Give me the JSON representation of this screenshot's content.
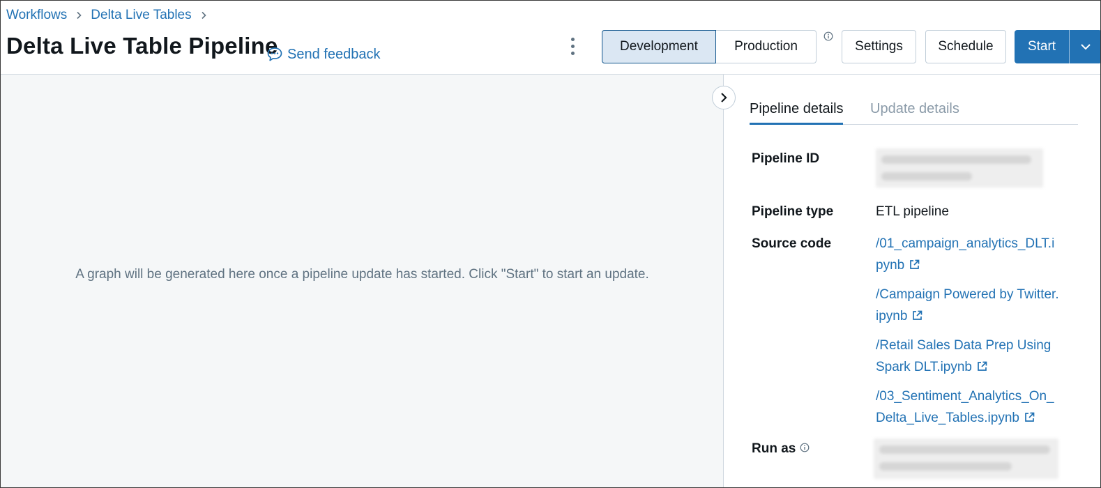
{
  "breadcrumb": {
    "items": [
      "Workflows",
      "Delta Live Tables"
    ]
  },
  "header": {
    "title": "Delta Live Table Pipeline",
    "feedback": "Send feedback",
    "mode": {
      "development": "Development",
      "production": "Production",
      "selected": "Development"
    },
    "settings": "Settings",
    "schedule": "Schedule",
    "start": "Start"
  },
  "graph": {
    "message": "A graph will be generated here once a pipeline update has started. Click \"Start\" to start an update."
  },
  "details": {
    "tabs": [
      {
        "label": "Pipeline details",
        "active": true
      },
      {
        "label": "Update details",
        "active": false
      }
    ],
    "pipeline_id_label": "Pipeline ID",
    "pipeline_type_label": "Pipeline type",
    "pipeline_type_value": "ETL pipeline",
    "source_code_label": "Source code",
    "source_files": [
      "/01_campaign_analytics_DLT.ipynb",
      "/Campaign Powered by Twitter.ipynb",
      "/Retail Sales Data Prep Using Spark DLT.ipynb",
      "/03_Sentiment_Analytics_On_Delta_Live_Tables.ipynb"
    ],
    "run_as_label": "Run as"
  },
  "icons": {
    "breadcrumb_separator": "chevron-right-icon",
    "feedback": "chat-bubble-icon",
    "menu": "kebab-menu-icon",
    "mode_info": "info-icon",
    "start_menu": "chevron-down-icon",
    "panel_toggle": "chevron-right-icon",
    "external_link": "external-link-icon"
  },
  "colors": {
    "accent": "#2272b4",
    "mode_selected_bg": "#dbe7f3",
    "graph_bg": "#f5f7f8",
    "muted_text": "#5f7281"
  }
}
